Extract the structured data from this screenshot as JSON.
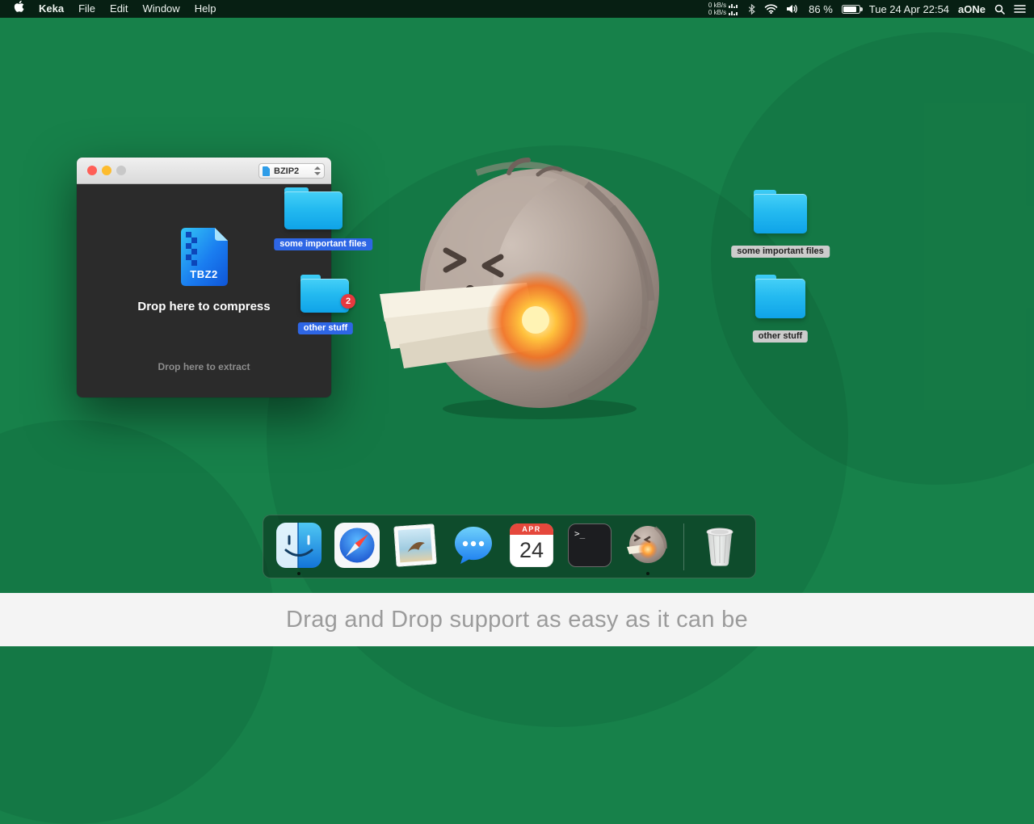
{
  "menu_bar": {
    "app_name": "Keka",
    "menus": [
      "File",
      "Edit",
      "Window",
      "Help"
    ],
    "status": {
      "net_up": "0 kB/s",
      "net_down": "0 kB/s",
      "battery_pct": "86 %",
      "clock": "Tue 24 Apr 22:54",
      "account": "aONe"
    }
  },
  "keka_window": {
    "format": "BZIP2",
    "file_badge": "TBZ2",
    "compress_text": "Drop here to compress",
    "extract_text": "Drop here to extract"
  },
  "drag_folders": {
    "first_label": "some important files",
    "second_label": "other stuff",
    "second_badge": "2"
  },
  "desktop_folders": {
    "first_label": "some important files",
    "second_label": "other stuff"
  },
  "dock": {
    "calendar_month": "APR",
    "calendar_day": "24",
    "terminal_prompt": ">_"
  },
  "caption": "Drag and Drop support as easy as it can be",
  "colors": {
    "desktop_green": "#17814a",
    "folder_cyan": "#29c1f2",
    "accent_blue": "#2e66e5",
    "badge_red": "#e7393f"
  }
}
